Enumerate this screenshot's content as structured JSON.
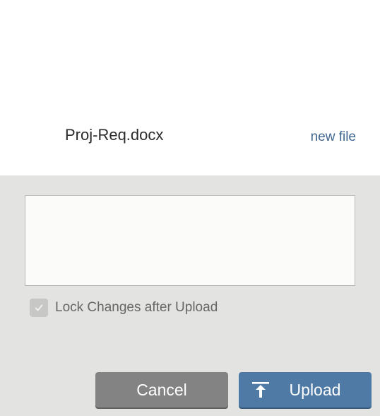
{
  "file": {
    "name": "Proj-Req.docx",
    "new_file_link": "new file"
  },
  "comment": {
    "value": "",
    "placeholder": ""
  },
  "lock": {
    "label": "Lock Changes after Upload",
    "checked": true
  },
  "actions": {
    "cancel_label": "Cancel",
    "upload_label": "Upload"
  },
  "icons": {
    "checkbox": "checkmark-icon",
    "upload": "upload-arrow-icon"
  },
  "colors": {
    "link": "#3f6790",
    "upload_button": "#4f7aa6",
    "cancel_button": "#838383",
    "panel_background": "#e3e3e2"
  }
}
